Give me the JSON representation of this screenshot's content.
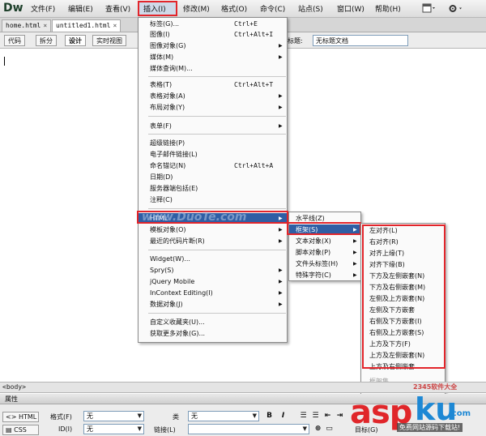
{
  "app": {
    "logo": "Dw"
  },
  "menubar": {
    "items": [
      {
        "label": "文件(F)"
      },
      {
        "label": "编辑(E)"
      },
      {
        "label": "查看(V)"
      },
      {
        "label": "插入(I)"
      },
      {
        "label": "修改(M)"
      },
      {
        "label": "格式(O)"
      },
      {
        "label": "命令(C)"
      },
      {
        "label": "站点(S)"
      },
      {
        "label": "窗口(W)"
      },
      {
        "label": "帮助(H)"
      }
    ],
    "active": "插入(I)"
  },
  "tabs": [
    {
      "label": "home.html",
      "close": "×"
    },
    {
      "label": "untitled1.html",
      "close": "×"
    }
  ],
  "toolbar": {
    "buttons": [
      "代码",
      "拆分",
      "设计",
      "实时视图"
    ],
    "title_label": "标题:",
    "title_value": "无标题文档"
  },
  "insert_menu": {
    "items": [
      {
        "label": "标签(G)...",
        "shortcut": "Ctrl+E"
      },
      {
        "label": "图像(I)",
        "shortcut": "Ctrl+Alt+I"
      },
      {
        "label": "图像对象(G)",
        "submenu": "▶"
      },
      {
        "label": "媒体(M)",
        "submenu": "▶"
      },
      {
        "label": "媒体查询(M)..."
      },
      {
        "label": "表格(T)",
        "shortcut": "Ctrl+Alt+T"
      },
      {
        "label": "表格对象(A)",
        "submenu": "▶"
      },
      {
        "label": "布局对象(Y)",
        "submenu": "▶"
      },
      {
        "label": "表单(F)",
        "submenu": "▶"
      },
      {
        "label": "超级链接(P)"
      },
      {
        "label": "电子邮件链接(L)"
      },
      {
        "label": "命名锚记(N)",
        "shortcut": "Ctrl+Alt+A"
      },
      {
        "label": "日期(D)"
      },
      {
        "label": "服务器端包括(E)"
      },
      {
        "label": "注释(C)"
      },
      {
        "label": "HTML",
        "submenu": "▶"
      },
      {
        "label": "模板对象(O)",
        "submenu": "▶"
      },
      {
        "label": "最近的代码片断(R)",
        "submenu": "▶"
      },
      {
        "label": "Widget(W)..."
      },
      {
        "label": "Spry(S)",
        "submenu": "▶"
      },
      {
        "label": "jQuery Mobile",
        "submenu": "▶"
      },
      {
        "label": "InContext Editing(I)",
        "submenu": "▶"
      },
      {
        "label": "数据对象(J)",
        "submenu": "▶"
      },
      {
        "label": "自定义收藏夹(U)..."
      },
      {
        "label": "获取更多对象(G)..."
      }
    ]
  },
  "html_submenu": {
    "items": [
      {
        "label": "水平线(Z)"
      },
      {
        "label": "框架(S)",
        "submenu": "▶"
      },
      {
        "label": "文本对象(X)",
        "submenu": "▶"
      },
      {
        "label": "脚本对象(P)",
        "submenu": "▶"
      },
      {
        "label": "文件头标签(H)",
        "submenu": "▶"
      },
      {
        "label": "特殊字符(C)",
        "submenu": "▶"
      }
    ]
  },
  "frames_submenu": {
    "items": [
      {
        "label": "左对齐(L)"
      },
      {
        "label": "右对齐(R)"
      },
      {
        "label": "对齐上缘(T)"
      },
      {
        "label": "对齐下缘(B)"
      },
      {
        "label": "下方及左侧嵌套(N)"
      },
      {
        "label": "下方及右侧嵌套(M)"
      },
      {
        "label": "左侧及上方嵌套(N)"
      },
      {
        "label": "左侧及下方嵌套"
      },
      {
        "label": "右侧及下方嵌套(I)"
      },
      {
        "label": "右侧及上方嵌套(S)"
      },
      {
        "label": "上方及下方(F)"
      },
      {
        "label": "上方及左侧嵌套(N)"
      },
      {
        "label": "上方及右侧嵌套"
      }
    ],
    "extra": [
      "框架集",
      "框架"
    ]
  },
  "statusbar": {
    "tag": "<body>"
  },
  "properties": {
    "title": "属性",
    "html_button": "HTML",
    "css_button": "CSS",
    "format_label": "格式(F)",
    "format_value": "无",
    "class_label": "类",
    "class_value": "无",
    "id_label": "ID(I)",
    "id_value": "无",
    "link_label": "链接(L)",
    "target_label": "目标(G)",
    "bold": "B",
    "italic": "I"
  },
  "watermarks": {
    "center": "www.DuoTe.com",
    "brand_asp": "asp",
    "brand_ku": "ku",
    "brand_cn": ".com",
    "brand_sub": "免费网站源码下载站!",
    "site2345": "2345软件大全"
  },
  "colors": {
    "highlight": "#2f5ea4",
    "annotation": "#e2252b"
  }
}
